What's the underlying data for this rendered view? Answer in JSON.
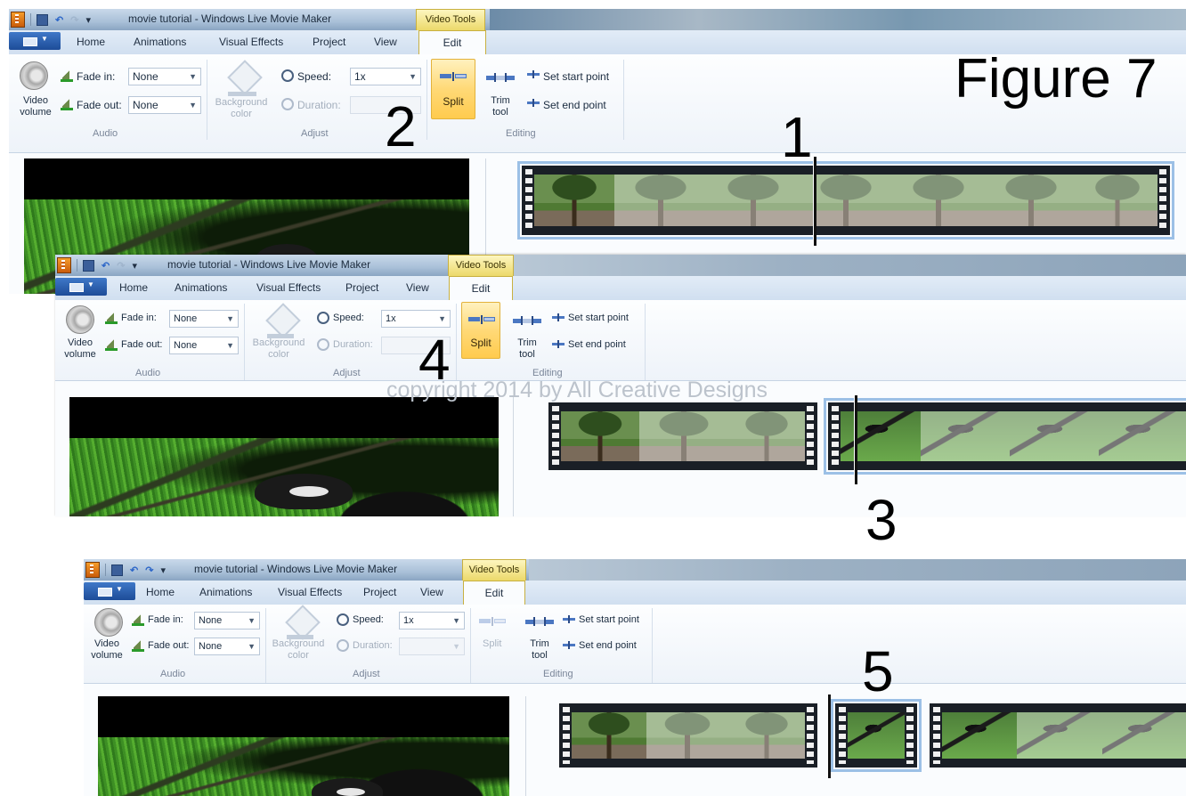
{
  "figure": {
    "title": "Figure 7",
    "copyright": "copyright 2014 by All Creative Designs"
  },
  "annotations": [
    "1",
    "2",
    "3",
    "4",
    "5"
  ],
  "window": {
    "title": "movie tutorial - Windows Live Movie Maker",
    "contextual_tab": "Video Tools",
    "tabs": [
      "Home",
      "Animations",
      "Visual Effects",
      "Project",
      "View",
      "Edit"
    ],
    "active_tab": "Edit"
  },
  "ribbon": {
    "audio": {
      "group_label": "Audio",
      "video_volume": "Video volume",
      "fade_in_label": "Fade in:",
      "fade_in_value": "None",
      "fade_out_label": "Fade out:",
      "fade_out_value": "None"
    },
    "adjust": {
      "group_label": "Adjust",
      "background_color": "Background color",
      "speed_label": "Speed:",
      "speed_value": "1x",
      "duration_label": "Duration:"
    },
    "editing": {
      "group_label": "Editing",
      "split": "Split",
      "trim_tool": "Trim tool",
      "set_start_point": "Set start point",
      "set_end_point": "Set end point"
    }
  },
  "colors": {
    "ribbon_bg": "#fafcfe",
    "contextual_tab": "#ecd96a",
    "file_button": "#1d4c98",
    "split_active": "#ffd977"
  }
}
